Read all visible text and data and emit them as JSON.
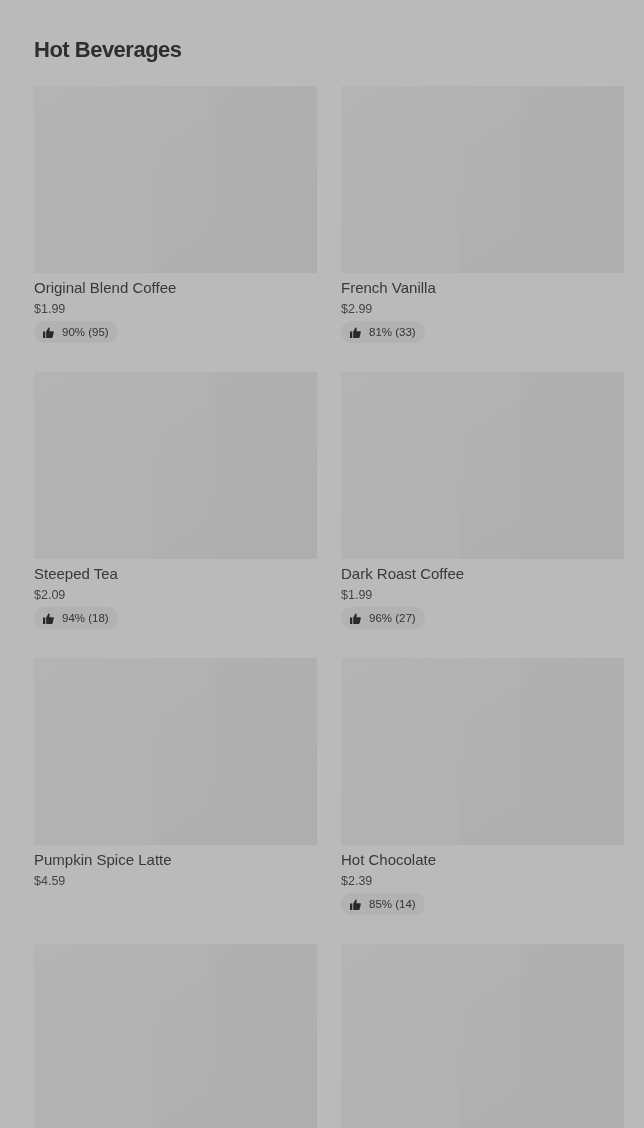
{
  "section": {
    "title": "Hot Beverages"
  },
  "items": [
    {
      "image": {
        "kind": "picture"
      },
      "name": "Original Blend Coffee",
      "price": "$1.99",
      "rating": "90% (95)"
    },
    {
      "image": {
        "kind": "picture"
      },
      "name": "French Vanilla",
      "price": "$2.99",
      "rating": "81% (33)"
    },
    {
      "image": {
        "kind": "picture"
      },
      "name": "Steeped Tea",
      "price": "$2.09",
      "rating": "94% (18)"
    },
    {
      "image": {
        "kind": "picture"
      },
      "name": "Dark Roast Coffee",
      "price": "$1.99",
      "rating": "96% (27)"
    },
    {
      "image": {
        "kind": "picture"
      },
      "name": "Pumpkin Spice Latte",
      "price": "$4.59"
    },
    {
      "image": {
        "kind": "picture"
      },
      "name": "Hot Chocolate",
      "price": "$2.39",
      "rating": "85% (14)"
    },
    {
      "image": {
        "kind": "picture"
      }
    },
    {
      "image": {
        "kind": "picture"
      }
    }
  ]
}
